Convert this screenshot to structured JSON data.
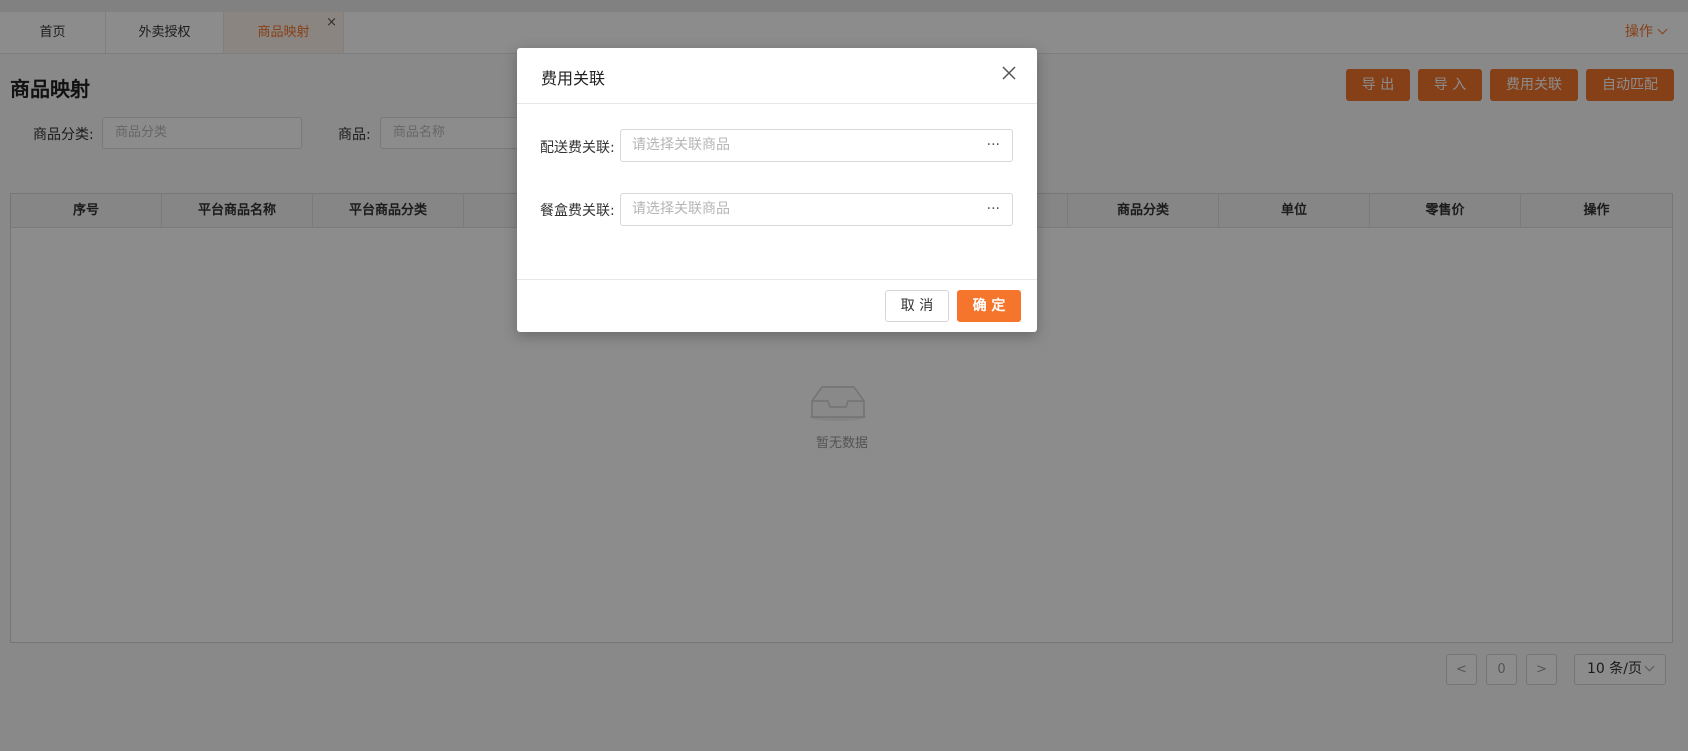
{
  "tabs": [
    {
      "label": "首页"
    },
    {
      "label": "外卖授权"
    },
    {
      "label": "商品映射",
      "close": "×"
    }
  ],
  "header": {
    "ops_label": "操作"
  },
  "page": {
    "title": "商品映射"
  },
  "actions": {
    "export": "导 出",
    "import": "导 入",
    "fee_link": "费用关联",
    "auto_match": "自动匹配"
  },
  "filters": {
    "category_label": "商品分类:",
    "category_placeholder": "商品分类",
    "product_label": "商品:",
    "product_placeholder": "商品名称"
  },
  "table": {
    "columns": [
      "序号",
      "平台商品名称",
      "平台商品分类",
      "",
      "",
      "",
      "",
      "商品分类",
      "单位",
      "零售价",
      "操作"
    ],
    "empty_text": "暂无数据"
  },
  "pagination": {
    "prev": "<",
    "current": "0",
    "next": ">",
    "page_size": "10 条/页"
  },
  "dialog": {
    "title": "费用关联",
    "delivery_label": "配送费关联:",
    "delivery_placeholder": "请选择关联商品",
    "box_label": "餐盒费关联:",
    "box_placeholder": "请选择关联商品",
    "more": "···",
    "cancel": "取 消",
    "ok": "确 定"
  },
  "colors": {
    "accent": "#f5752c",
    "mask": "rgba(0,0,0,0.45)"
  }
}
